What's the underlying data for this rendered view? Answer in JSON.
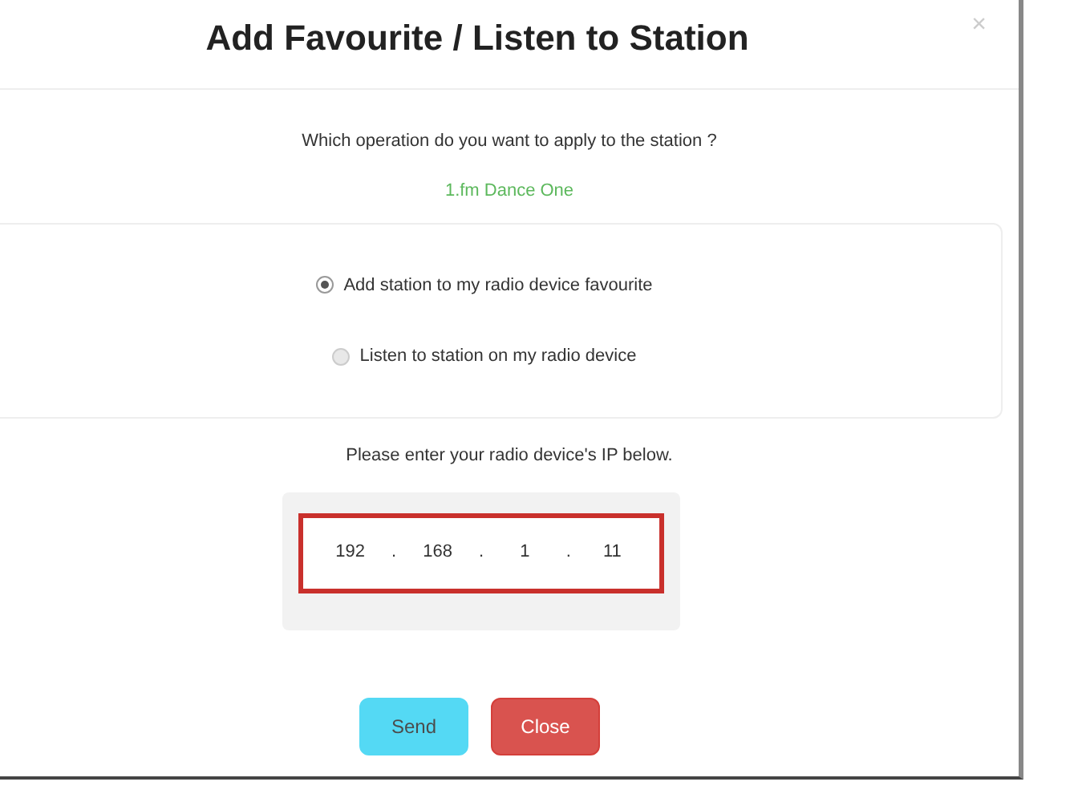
{
  "dialog": {
    "title": "Add Favourite / Listen to Station",
    "close_symbol": "×"
  },
  "question": "Which operation do you want to apply to the station ?",
  "station": "1.fm Dance One",
  "options": [
    {
      "label": "Add station to my radio device favourite",
      "selected": true
    },
    {
      "label": "Listen to station on my radio device",
      "selected": false
    }
  ],
  "ip_prompt": "Please enter your radio device's IP below.",
  "ip": {
    "octets": [
      "192",
      "168",
      "1",
      "11"
    ],
    "separators": [
      ".",
      ".",
      "."
    ],
    "invalid": true
  },
  "buttons": [
    {
      "label": "Send",
      "kind": "info",
      "disabled": true
    },
    {
      "label": "Close",
      "kind": "danger",
      "disabled": false
    }
  ]
}
